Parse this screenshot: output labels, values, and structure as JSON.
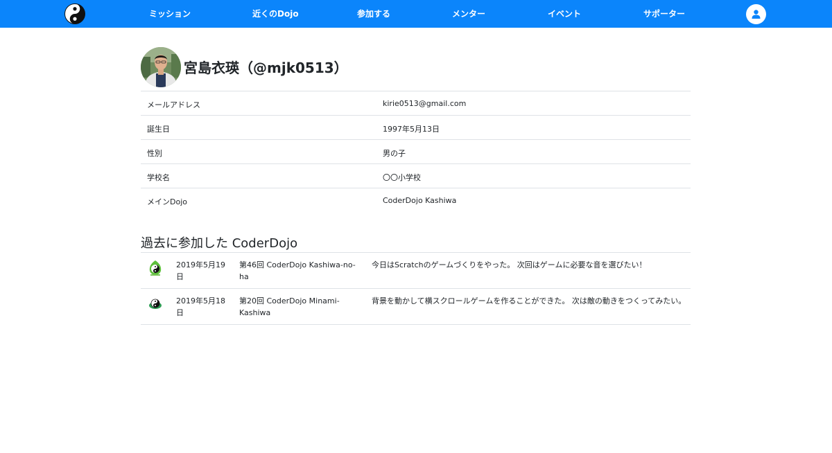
{
  "nav": {
    "logo": "coderdojo-logo",
    "items": [
      {
        "label": "ミッション"
      },
      {
        "label": "近くのDojo"
      },
      {
        "label": "参加する"
      },
      {
        "label": "メンター"
      },
      {
        "label": "イベント"
      },
      {
        "label": "サポーター"
      }
    ],
    "user_icon": "user-icon",
    "bar_color": "#0b85fb"
  },
  "profile": {
    "name": "宮島衣瑛（@mjk0513）",
    "fields": [
      {
        "key": "メールアドレス",
        "value": "kirie0513@gmail.com"
      },
      {
        "key": "誕生日",
        "value": "1997年5月13日"
      },
      {
        "key": "性別",
        "value": "男の子"
      },
      {
        "key": "学校名",
        "value": "〇〇小学校"
      },
      {
        "key": "メインDojo",
        "value": "CoderDojo Kashiwa"
      }
    ]
  },
  "history": {
    "title": "過去に参加した CoderDojo",
    "rows": [
      {
        "logo": "coderdojo-kashiwa-no-ha-logo",
        "date": "2019年5月19日",
        "event": "第46回 CoderDojo Kashiwa-no-ha",
        "note": "今日はScratchのゲームづくりをやった。 次回はゲームに必要な音を選びたい！"
      },
      {
        "logo": "coderdojo-minami-kashiwa-logo",
        "date": "2019年5月18日",
        "event": "第20回 CoderDojo Minami-Kashiwa",
        "note": "背景を動かして横スクロールゲームを作ることができた。 次は敵の動きをつくってみたい。"
      }
    ]
  }
}
